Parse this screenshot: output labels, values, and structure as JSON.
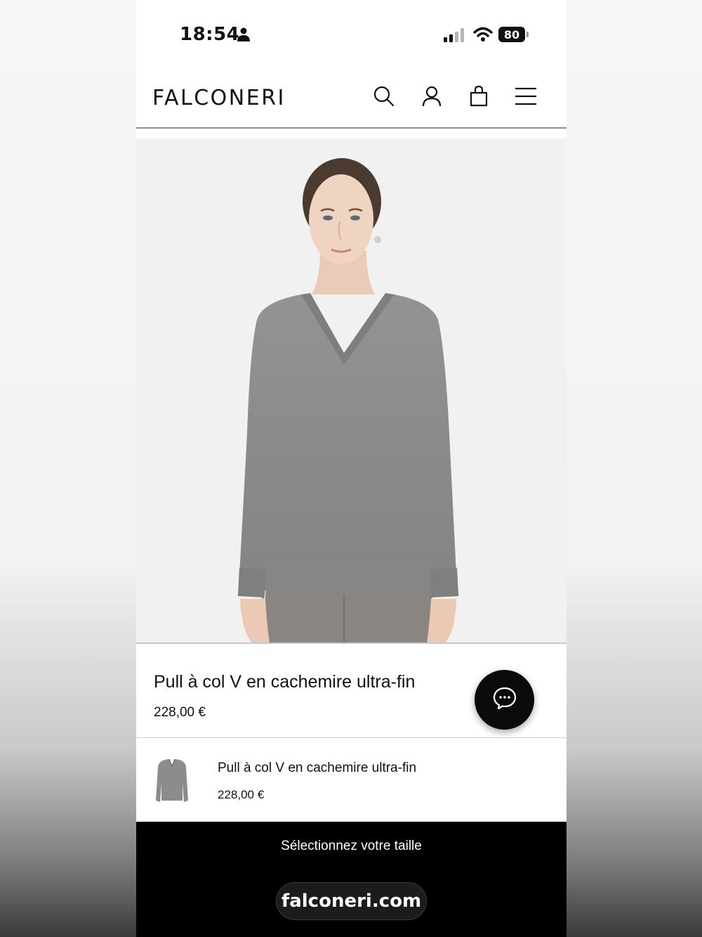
{
  "status_bar": {
    "time": "18:54",
    "battery": "80",
    "icons": [
      "person-icon",
      "signal-icon",
      "wifi-icon",
      "battery-icon"
    ]
  },
  "header": {
    "logo": "FALCONERI",
    "icons": [
      "search-icon",
      "account-icon",
      "bag-icon",
      "menu-icon"
    ]
  },
  "product": {
    "image_alt": "Model wearing grey V-neck sweater",
    "title": "Pull à col V en cachemire ultra-fin",
    "price": "228,00 €"
  },
  "chat": {
    "icon": "chat-bubble-icon"
  },
  "sticky_bar": {
    "title": "Pull à col V en cachemire ultra-fin",
    "price": "228,00 €"
  },
  "cta": {
    "label": "Sélectionnez votre taille"
  },
  "browser": {
    "url": "falconeri.com"
  },
  "colors": {
    "sweater": "#8d8d8d",
    "background": "#f1f1f1",
    "cta_bg": "#000000"
  }
}
